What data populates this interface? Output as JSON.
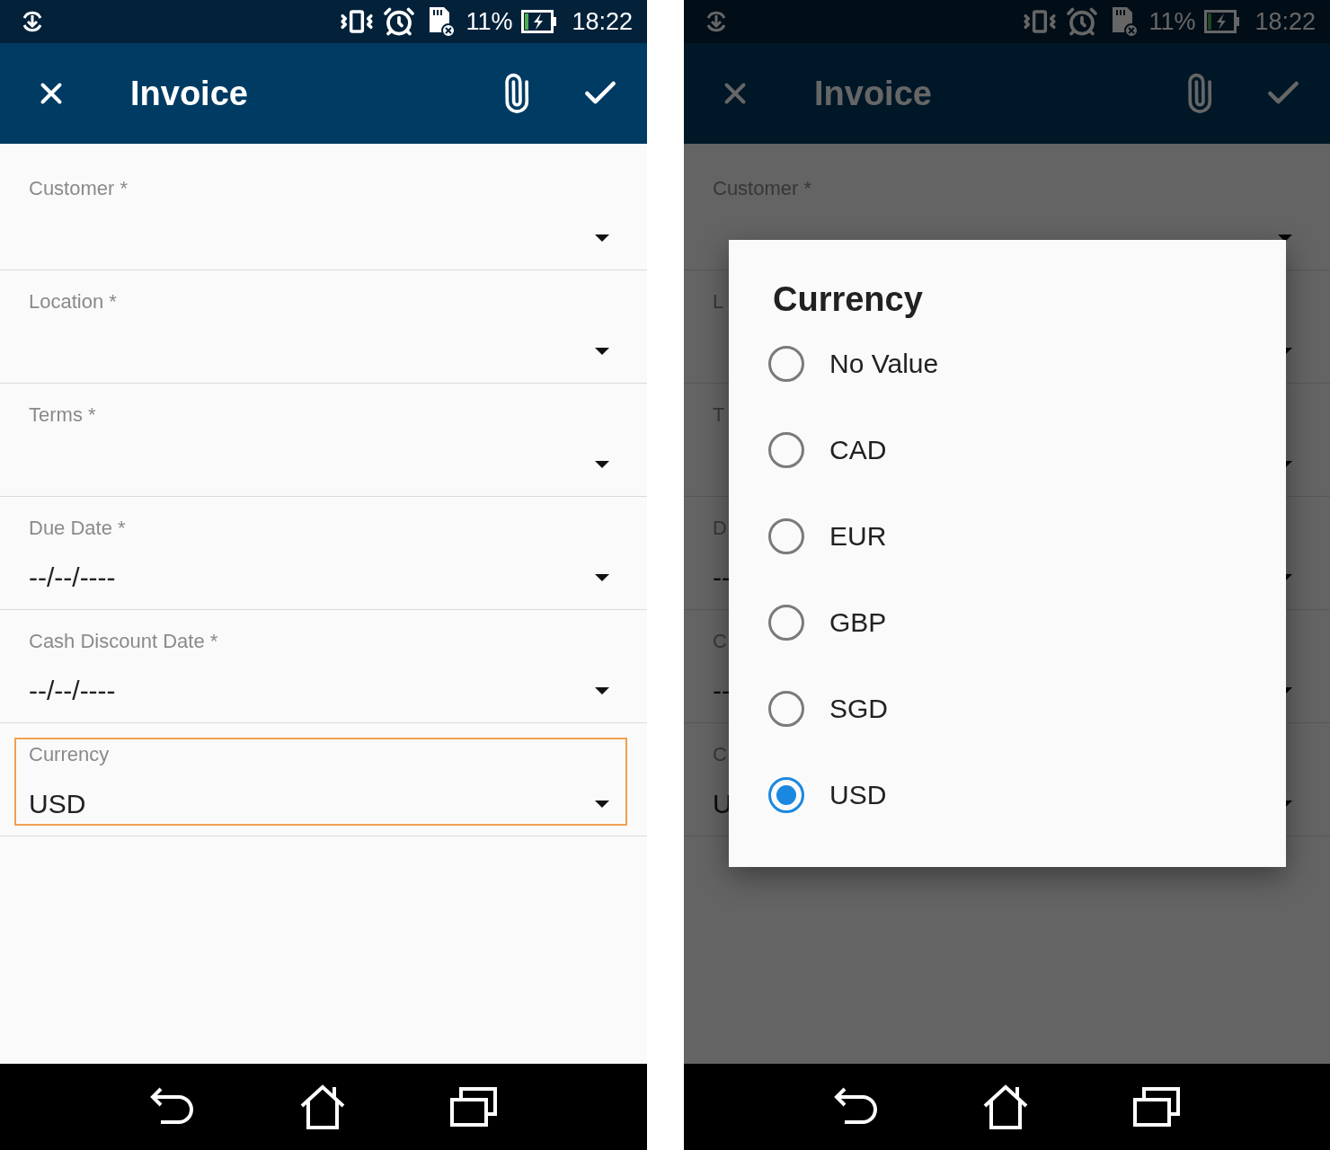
{
  "screens": [
    {
      "status_bar": {
        "battery": "11%",
        "time": "18:22"
      },
      "app_bar": {
        "title": "Invoice"
      },
      "dimmed": false,
      "fields": [
        {
          "label": "Customer *",
          "focused": false
        },
        {
          "label": "Location *",
          "focused": false
        },
        {
          "label": "Terms *",
          "focused": false
        },
        {
          "label": "Due Date *",
          "value": "--/--/----",
          "focused": false
        },
        {
          "label": "Cash Discount Date *",
          "value": "--/--/----",
          "focused": false
        },
        {
          "label": "Currency",
          "value": "USD",
          "focused": true
        }
      ]
    },
    {
      "status_bar": {
        "battery": "11%",
        "time": "18:22"
      },
      "app_bar": {
        "title": "Invoice"
      },
      "dimmed": true,
      "fields": [
        {
          "label": "Customer *",
          "focused": false
        },
        {
          "label": "L",
          "focused": false
        },
        {
          "label": "T",
          "focused": false
        },
        {
          "label": "D",
          "value": "--",
          "focused": false
        },
        {
          "label": "C",
          "value": "--",
          "focused": false
        },
        {
          "label": "C",
          "value": "U",
          "focused": false
        }
      ],
      "dialog": {
        "title": "Currency",
        "options": [
          {
            "label": "No Value",
            "selected": false
          },
          {
            "label": "CAD",
            "selected": false
          },
          {
            "label": "EUR",
            "selected": false
          },
          {
            "label": "GBP",
            "selected": false
          },
          {
            "label": "SGD",
            "selected": false
          },
          {
            "label": "USD",
            "selected": true
          }
        ]
      }
    }
  ]
}
